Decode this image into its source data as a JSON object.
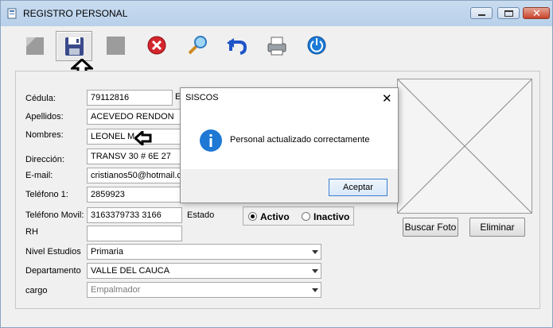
{
  "window": {
    "title": "REGISTRO PERSONAL"
  },
  "toolbar": {
    "buttons": [
      {
        "icon": "new-icon"
      },
      {
        "icon": "save-icon"
      },
      {
        "icon": "disabled-icon"
      },
      {
        "icon": "delete-icon"
      },
      {
        "icon": "search-icon"
      },
      {
        "icon": "undo-icon"
      },
      {
        "icon": "print-icon"
      },
      {
        "icon": "power-icon"
      }
    ]
  },
  "form": {
    "cedula_label": "Cédula:",
    "cedula_value": "79112816",
    "cedula_suffix": "E",
    "apellidos_label": "Apellidos:",
    "apellidos_value": "ACEVEDO RENDON",
    "nombres_label": "Nombres:",
    "nombres_value": "LEONEL M",
    "direccion_label": "Dirección:",
    "direccion_value": "TRANSV 30 # 6E 27",
    "email_label": "E-mail:",
    "email_value": "cristianos50@hotmail.co",
    "telefono1_label": "Teléfono 1:",
    "telefono1_value": "2859923",
    "telefono_movil_label": "Teléfono Movil:",
    "telefono_movil_value": "3163379733 3166",
    "estado_label": "Estado",
    "estado_options": [
      "Activo",
      "Inactivo"
    ],
    "estado_selected": "Activo",
    "rh_label": "RH",
    "rh_value": "",
    "nivel_estudios_label": "Nivel Estudios",
    "nivel_estudios_value": "Primaria",
    "departamento_label": "Departamento",
    "departamento_value": "VALLE DEL CAUCA",
    "cargo_label": "cargo",
    "cargo_value": "Empalmador"
  },
  "photo": {
    "buscar_label": "Buscar Foto",
    "eliminar_label": "Eliminar"
  },
  "dialog": {
    "title": "SISCOS",
    "close_glyph": "✕",
    "message": "Personal actualizado correctamente",
    "ok_label": "Aceptar"
  },
  "colors": {
    "titlebar": "#b8d0ea",
    "dialog_button_border": "#3c7fd1",
    "info_icon": "#1e78d4"
  }
}
